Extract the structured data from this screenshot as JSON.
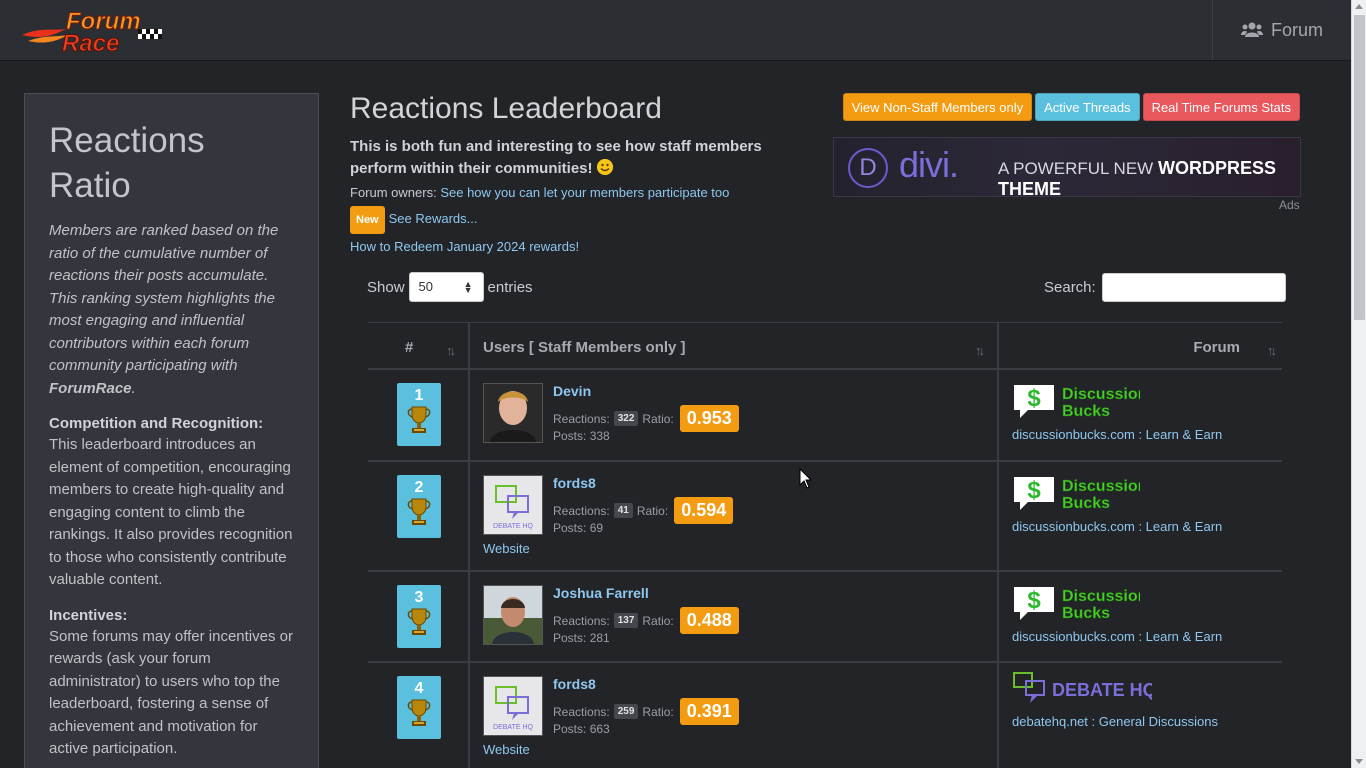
{
  "nav": {
    "logo_line1": "Forum",
    "logo_line2": "Race",
    "forum_label": "Forum"
  },
  "sidebar": {
    "title": "Reactions Ratio",
    "intro": "Members are ranked based on the ratio of the cumulative number of reactions their posts accumulate. This ranking system highlights the most engaging and influential contributors within each forum community participating with ",
    "intro_brand": "ForumRace",
    "intro_end": ".",
    "sections": [
      {
        "heading": "Competition and Recognition:",
        "text": "This leaderboard introduces an element of competition, encouraging members to create high-quality and engaging content to climb the rankings. It also provides recognition to those who consistently contribute valuable content."
      },
      {
        "heading": "Incentives:",
        "text": "Some forums may offer incentives or rewards (ask your forum administrator) to users who top the leaderboard, fostering a sense of achievement and motivation for active participation."
      }
    ]
  },
  "main": {
    "title": "Reactions Leaderboard",
    "buttons": {
      "non_staff": "View Non-Staff Members only",
      "active": "Active Threads",
      "realtime": "Real Time Forums Stats"
    },
    "desc_bold": "This is both fun and interesting to see how staff members perform within their communities!",
    "owners_prefix": "Forum owners:",
    "owners_link": "See how you can let your members participate too",
    "new_badge": "New",
    "rewards_link": "See Rewards...",
    "redeem_link": "How to Redeem January 2024 rewards!"
  },
  "ad": {
    "word": "divi.",
    "tag_prefix": "A POWERFUL NEW",
    "tag_bold": "WORDPRESS THEME",
    "label": "Ads",
    "logo_letter": "D"
  },
  "table": {
    "show_label": "Show",
    "entries_value": "50",
    "entries_label": "entries",
    "search_label": "Search:",
    "headers": {
      "rank": "#",
      "users": "Users [ Staff Members only ]",
      "forum": "Forum"
    },
    "reactions_label": "Reactions:",
    "ratio_label": "Ratio:",
    "posts_label": "Posts:",
    "rows": [
      {
        "rank": "1",
        "user": "Devin",
        "reactions": "322",
        "ratio": "0.953",
        "posts": "338",
        "website": "",
        "forum_logo": "discussionbucks",
        "forum": "discussionbucks.com : Learn & Earn"
      },
      {
        "rank": "2",
        "user": "fords8",
        "reactions": "41",
        "ratio": "0.594",
        "posts": "69",
        "website": "Website",
        "forum_logo": "discussionbucks",
        "forum": "discussionbucks.com : Learn & Earn"
      },
      {
        "rank": "3",
        "user": "Joshua Farrell",
        "reactions": "137",
        "ratio": "0.488",
        "posts": "281",
        "website": "",
        "forum_logo": "discussionbucks",
        "forum": "discussionbucks.com : Learn & Earn"
      },
      {
        "rank": "4",
        "user": "fords8",
        "reactions": "259",
        "ratio": "0.391",
        "posts": "663",
        "website": "Website",
        "forum_logo": "debatehq",
        "forum": "debatehq.net : General Discussions"
      }
    ]
  },
  "logos": {
    "db_line1": "Discussion",
    "db_line2": "Bucks",
    "dhq": "DEBATE HQ",
    "dhq_small": "DEBATE HQ"
  },
  "colors": {
    "accent_orange": "#f39c12",
    "accent_blue": "#5bc0de",
    "accent_red": "#e9585c",
    "link": "#8fc7ef"
  }
}
